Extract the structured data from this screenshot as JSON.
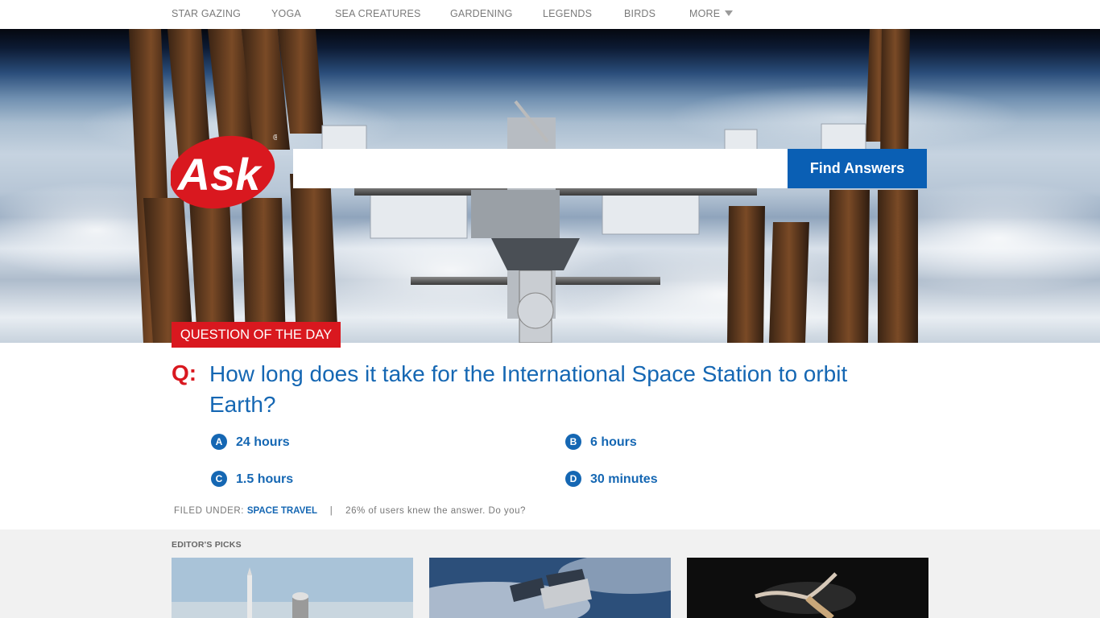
{
  "nav": {
    "items": [
      "STAR GAZING",
      "YOGA",
      "SEA CREATURES",
      "GARDENING",
      "LEGENDS",
      "BIRDS",
      "MORE"
    ]
  },
  "logo": {
    "text": "Ask",
    "mark": "®"
  },
  "search": {
    "value": "",
    "placeholder": "",
    "button_label": "Find Answers"
  },
  "qotd": {
    "label": "QUESTION OF THE DAY",
    "q_prefix": "Q:",
    "question": "How long does it take for the International Space Station to orbit Earth?",
    "answers": [
      {
        "letter": "A",
        "text": "24 hours"
      },
      {
        "letter": "B",
        "text": "6 hours"
      },
      {
        "letter": "C",
        "text": "1.5 hours"
      },
      {
        "letter": "D",
        "text": "30 minutes"
      }
    ],
    "filed_label": "FILED UNDER:",
    "topic": "SPACE TRAVEL",
    "separator": "|",
    "stat": "26% of users knew the answer. Do you?"
  },
  "picks": {
    "title": "EDITOR'S PICKS"
  },
  "colors": {
    "accent_red": "#d9181f",
    "link_blue": "#1567b3",
    "button_blue": "#0a5fb4"
  }
}
